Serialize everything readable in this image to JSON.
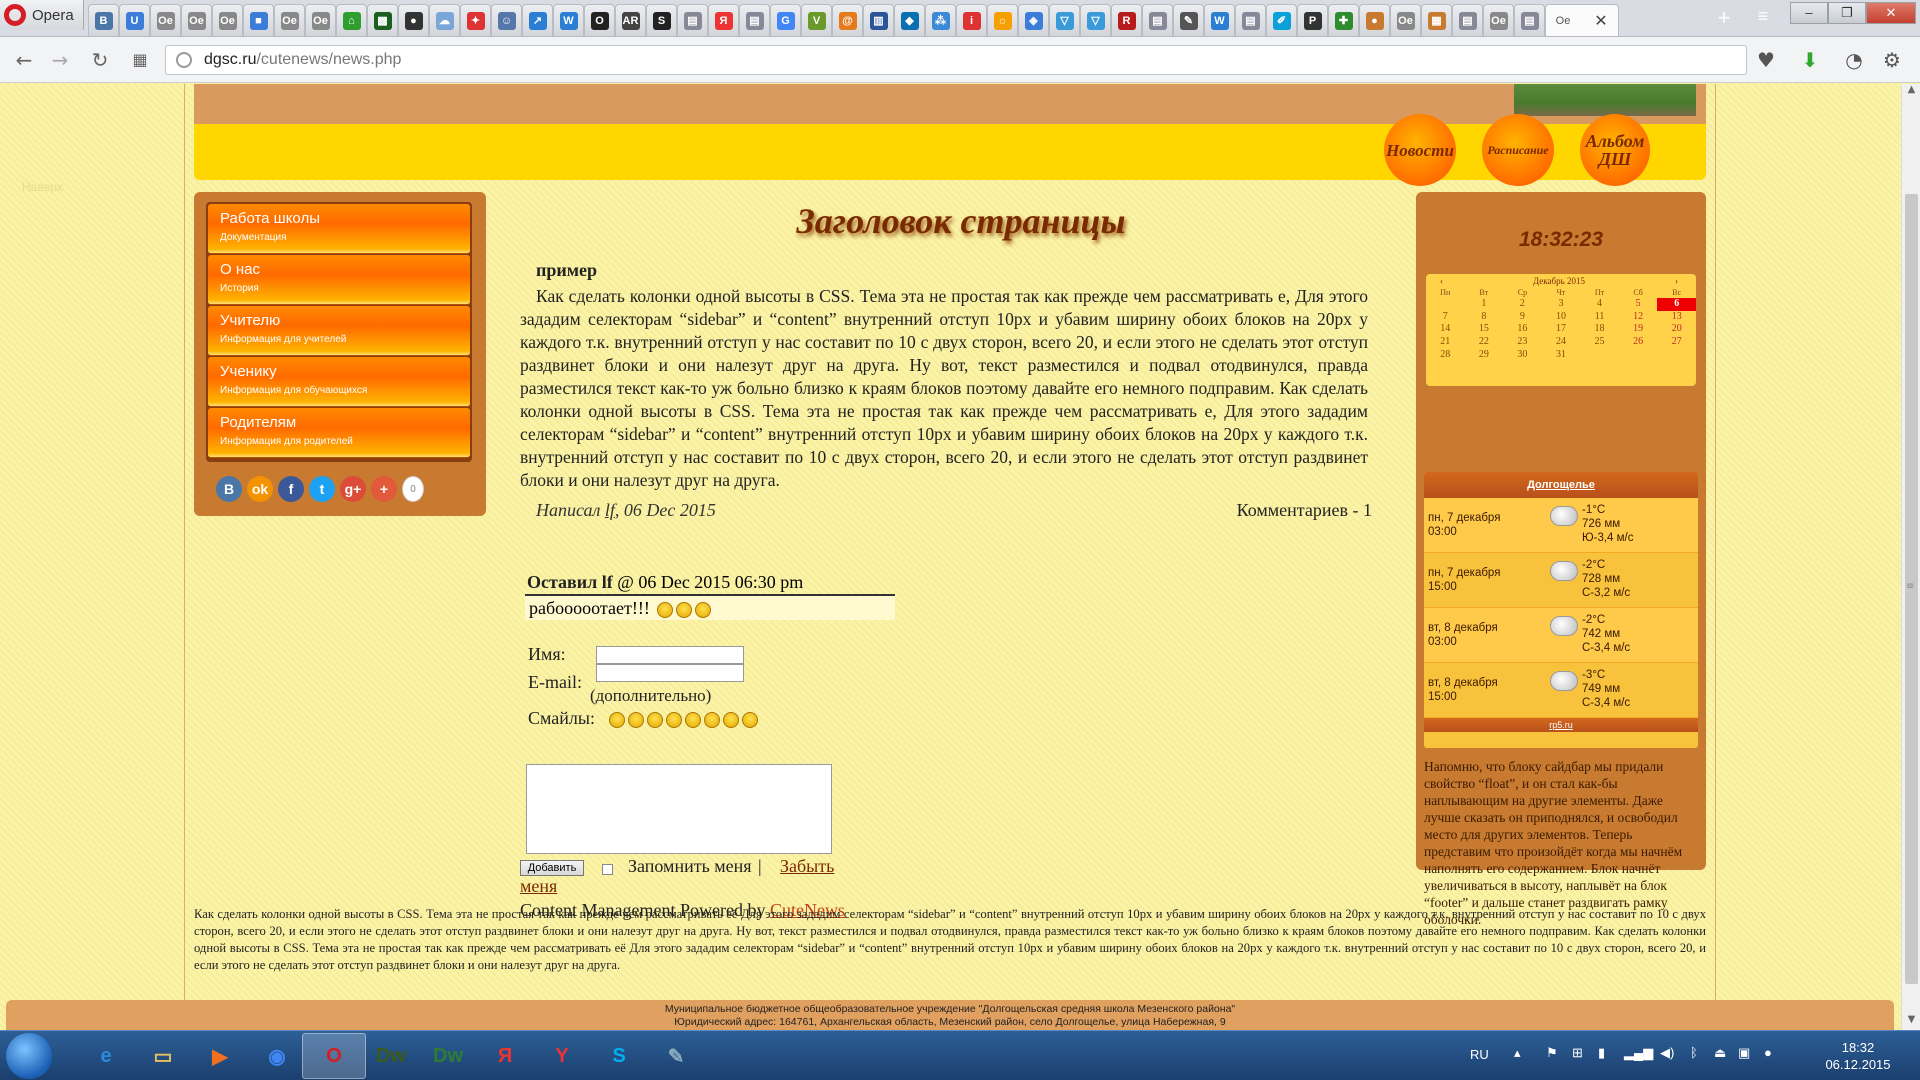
{
  "browser": {
    "name": "Opera",
    "url_host": "dgsc.ru",
    "url_path": "/cutenews/news.php",
    "active_tab_label": "Ое",
    "tabs": [
      {
        "icon": "vk-icon",
        "color": "#4a76a8",
        "glyph": "В"
      },
      {
        "icon": "ucoz-icon",
        "color": "#3b7dd8",
        "glyph": "U"
      },
      {
        "icon": "page-icon",
        "color": "#888",
        "glyph": "Ое"
      },
      {
        "icon": "page-icon",
        "color": "#888",
        "glyph": "Ое"
      },
      {
        "icon": "page-icon",
        "color": "#888",
        "glyph": "Ое"
      },
      {
        "icon": "chat-icon",
        "color": "#3b7dd8",
        "glyph": "■"
      },
      {
        "icon": "page-icon",
        "color": "#888",
        "glyph": "Ое"
      },
      {
        "icon": "page-icon",
        "color": "#888",
        "glyph": "Ое"
      },
      {
        "icon": "home-icon",
        "color": "#2e9e2e",
        "glyph": "⌂"
      },
      {
        "icon": "minecraft-icon",
        "color": "#1b5e20",
        "glyph": "▩"
      },
      {
        "icon": "avatar-icon",
        "color": "#333",
        "glyph": "●"
      },
      {
        "icon": "weather-icon",
        "color": "#7aa7d8",
        "glyph": "☁"
      },
      {
        "icon": "game-icon",
        "color": "#d33",
        "glyph": "✦"
      },
      {
        "icon": "mascot-icon",
        "color": "#5577aa",
        "glyph": "☺"
      },
      {
        "icon": "arrow-icon",
        "color": "#2a7fd4",
        "glyph": "↗"
      },
      {
        "icon": "word-icon",
        "color": "#2a7fd4",
        "glyph": "W"
      },
      {
        "icon": "circle-icon",
        "color": "#222",
        "glyph": "O"
      },
      {
        "icon": "ar-icon",
        "color": "#444",
        "glyph": "AR"
      },
      {
        "icon": "s-icon",
        "color": "#222",
        "glyph": "S"
      },
      {
        "icon": "file-icon",
        "color": "#889",
        "glyph": "▤"
      },
      {
        "icon": "yandex-icon",
        "color": "#e33",
        "glyph": "Я"
      },
      {
        "icon": "file-icon",
        "color": "#889",
        "glyph": "▤"
      },
      {
        "icon": "google-icon",
        "color": "#4285f4",
        "glyph": "G"
      },
      {
        "icon": "v-icon",
        "color": "#6a9a2a",
        "glyph": "V"
      },
      {
        "icon": "spiral-icon",
        "color": "#e57a1c",
        "glyph": "@"
      },
      {
        "icon": "doc-icon",
        "color": "#2a5599",
        "glyph": "▥"
      },
      {
        "icon": "drupal-icon",
        "color": "#0a6fb0",
        "glyph": "◆"
      },
      {
        "icon": "nodes-icon",
        "color": "#3a8ad8",
        "glyph": "⁂"
      },
      {
        "icon": "i-icon",
        "color": "#d33",
        "glyph": "i"
      },
      {
        "icon": "sun-icon",
        "color": "#f5a000",
        "glyph": "☼"
      },
      {
        "icon": "shield-icon",
        "color": "#3b7dd8",
        "glyph": "◈"
      },
      {
        "icon": "vue-icon",
        "color": "#3b9ad8",
        "glyph": "▽"
      },
      {
        "icon": "vue-icon",
        "color": "#3b9ad8",
        "glyph": "▽"
      },
      {
        "icon": "r-icon",
        "color": "#b71c1c",
        "glyph": "R"
      },
      {
        "icon": "file-icon",
        "color": "#889",
        "glyph": "▤"
      },
      {
        "icon": "brush-icon",
        "color": "#555",
        "glyph": "✎"
      },
      {
        "icon": "w-icon",
        "color": "#2a7fd4",
        "glyph": "W"
      },
      {
        "icon": "file-icon",
        "color": "#889",
        "glyph": "▤"
      },
      {
        "icon": "feather-icon",
        "color": "#0aa0d8",
        "glyph": "✐"
      },
      {
        "icon": "p-icon",
        "color": "#333",
        "glyph": "P"
      },
      {
        "icon": "puzzle-icon",
        "color": "#2e8b2e",
        "glyph": "✚"
      },
      {
        "icon": "bear-icon",
        "color": "#c77a30",
        "glyph": "●"
      },
      {
        "icon": "page-icon",
        "color": "#888",
        "glyph": "Ое"
      },
      {
        "icon": "photo-icon",
        "color": "#c77a30",
        "glyph": "▦"
      },
      {
        "icon": "file-icon",
        "color": "#889",
        "glyph": "▤"
      },
      {
        "icon": "page-icon",
        "color": "#888",
        "glyph": "Ое"
      },
      {
        "icon": "file-icon",
        "color": "#889",
        "glyph": "▤"
      }
    ]
  },
  "header": {
    "nav": [
      {
        "label": "Новости"
      },
      {
        "label": "Расписание"
      },
      {
        "label": "Альбом ДШ"
      }
    ],
    "faint": "Наверх"
  },
  "sidebar": {
    "items": [
      {
        "label": "Работа школы",
        "sub": "Документация"
      },
      {
        "label": "О нас",
        "sub": "История"
      },
      {
        "label": "Учителю",
        "sub": "Информация для учителей"
      },
      {
        "label": "Ученику",
        "sub": "Информация для обучающихся"
      },
      {
        "label": "Родителям",
        "sub": "Информация для родителей"
      }
    ],
    "social": [
      {
        "name": "vk",
        "glyph": "В",
        "color": "#4a76a8"
      },
      {
        "name": "odnoklassniki",
        "glyph": "ok",
        "color": "#f59200"
      },
      {
        "name": "facebook",
        "glyph": "f",
        "color": "#3b5998"
      },
      {
        "name": "twitter",
        "glyph": "t",
        "color": "#1da1f2"
      },
      {
        "name": "google-plus",
        "glyph": "g+",
        "color": "#dd4b39"
      },
      {
        "name": "more",
        "glyph": "+",
        "color": "#e25a3a"
      }
    ],
    "share_count": "0"
  },
  "main": {
    "page_title": "Заголовок страницы",
    "news_title": "пример",
    "news_body": "Как сделать колонки одной высоты в CSS. Тема эта не простая так как прежде чем рассматривать е, Для этого зададим селекторам “sidebar” и “content” внутренний отступ 10px и убавим ширину обоих блоков на 20px у каждого т.к. внутренний отступ у нас составит по 10 с двух сторон, всего 20, и если этого не сделать этот отступ раздвинет блоки и они налезут друг на друга. Ну вот, текст разместился и подвал отодвинулся, правда разместился текст как-то уж больно близко к краям блоков поэтому давайте его немного подправим. Как сделать колонки одной высоты в CSS. Тема эта не простая так как прежде чем рассматривать е, Для этого зададим селекторам “sidebar” и “content” внутренний отступ 10px и убавим ширину обоих блоков на 20px у каждого т.к. внутренний отступ у нас составит по 10 с двух сторон, всего 20, и если этого не сделать этот отступ раздвинет блоки и они налезут друг на друга.",
    "meta_prefix": "Написал",
    "meta_author": "lf",
    "meta_date": ", 06 Dec 2015",
    "comments_label": "Комментариев - 1",
    "comment": {
      "prefix": "Оставил lf",
      "date": " @ 06 Dec 2015 06:30 pm",
      "text": "рабооооотает!!!"
    },
    "form": {
      "name_label": "Имя:",
      "email_label": "E-mail:",
      "optional": "(дополнительно)",
      "smiles_label": "Смайлы:",
      "name_value": "",
      "email_value": "",
      "message_value": "",
      "submit_label": "Добавить",
      "remember_label": "Запомнить меня",
      "sep": "|",
      "forget_label_1": "Забыть",
      "forget_label_2": "меня"
    },
    "powered_prefix": "Content Management Powered by ",
    "powered_link": "CuteNews"
  },
  "right": {
    "clock": "18:32:23",
    "calendar": {
      "prev": "‹",
      "month": "Декабрь 2015",
      "next": "›",
      "weekdays": [
        "Пн",
        "Вт",
        "Ср",
        "Чт",
        "Пт",
        "Сб",
        "Вс"
      ],
      "weeks": [
        [
          "",
          "1",
          "2",
          "3",
          "4",
          "5",
          "6"
        ],
        [
          "7",
          "8",
          "9",
          "10",
          "11",
          "12",
          "13"
        ],
        [
          "14",
          "15",
          "16",
          "17",
          "18",
          "19",
          "20"
        ],
        [
          "21",
          "22",
          "23",
          "24",
          "25",
          "26",
          "27"
        ],
        [
          "28",
          "29",
          "30",
          "31",
          "",
          "",
          ""
        ]
      ],
      "today": "6"
    },
    "weather": {
      "city": "Долгощелье",
      "rows": [
        {
          "date": "пн, 7 декабря",
          "time": "03:00",
          "temp": "-1°C",
          "pressure": "726 мм",
          "wind": "Ю-3,4 м/с"
        },
        {
          "date": "пн, 7 декабря",
          "time": "15:00",
          "temp": "-2°C",
          "pressure": "728 мм",
          "wind": "С-3,2 м/с"
        },
        {
          "date": "вт, 8 декабря",
          "time": "03:00",
          "temp": "-2°C",
          "pressure": "742 мм",
          "wind": "С-3,4 м/с"
        },
        {
          "date": "вт, 8 декабря",
          "time": "15:00",
          "temp": "-3°C",
          "pressure": "749 мм",
          "wind": "С-3,4 м/с"
        }
      ],
      "source": "rp5.ru"
    },
    "text": "Напомню, что блоку сайдбар мы придали свойство “float”, и он стал как-бы наплывающим на другие элементы. Даже лучше сказать он приподнялся, и освободил место для других элементов. Теперь представим что произойдёт когда мы начнём наполнять его содержанием. Блок начнёт увеличиваться в высоту, наплывёт на блок “footer” и дальше станет раздвигать рамку оболочки."
  },
  "footer": {
    "text": "Как сделать колонки одной высоты в CSS. Тема эта не простая так как прежде чем рассматривать её Для этого зададим селекторам “sidebar” и “content” внутренний отступ 10px и убавим ширину обоих блоков на 20px у каждого т.к. внутренний отступ у нас составит по 10 с двух сторон, всего 20, и если этого не сделать этот отступ раздвинет блоки и они налезут друг на друга. Ну вот, текст разместился и подвал отодвинулся, правда разместился текст как-то уж больно близко к краям блоков поэтому давайте его немного подправим. Как сделать колонки одной высоты в CSS. Тема эта не простая так как прежде чем рассматривать её Для этого зададим селекторам “sidebar” и “content” внутренний отступ 10px и убавим ширину обоих блоков на 20px у каждого т.к. внутренний отступ у нас составит по 10 с двух сторон, всего 20, и если этого не сделать этот отступ раздвинет блоки и они налезут друг на друга.",
    "org": "Муниципальное бюджетное общеобразовательное учреждение \"Долгощельская средняя школа Мезенского района\"",
    "address": "Юридический адрес: 164761, Архангельская область, Мезенский район, село Долгощелье, улица Набережная, 9"
  },
  "taskbar": {
    "apps": [
      {
        "name": "ie",
        "glyph": "e",
        "color": "#2a8ad8"
      },
      {
        "name": "explorer",
        "glyph": "▭",
        "color": "#e8c060"
      },
      {
        "name": "media-player",
        "glyph": "▶",
        "color": "#f07020"
      },
      {
        "name": "chrome",
        "glyph": "◉",
        "color": "#4285f4"
      },
      {
        "name": "opera",
        "glyph": "O",
        "color": "#d41d24"
      },
      {
        "name": "dreamweaver",
        "glyph": "Dw",
        "color": "#3a5a1a"
      },
      {
        "name": "dreamweaver-2",
        "glyph": "Dw",
        "color": "#2e7d32"
      },
      {
        "name": "yandex",
        "glyph": "Я",
        "color": "#e33"
      },
      {
        "name": "yandex-browser",
        "glyph": "Y",
        "color": "#e33"
      },
      {
        "name": "skype",
        "glyph": "S",
        "color": "#00aff0"
      },
      {
        "name": "notepad",
        "glyph": "✎",
        "color": "#8ab"
      }
    ],
    "lang": "RU",
    "time": "18:32",
    "date": "06.12.2015"
  }
}
